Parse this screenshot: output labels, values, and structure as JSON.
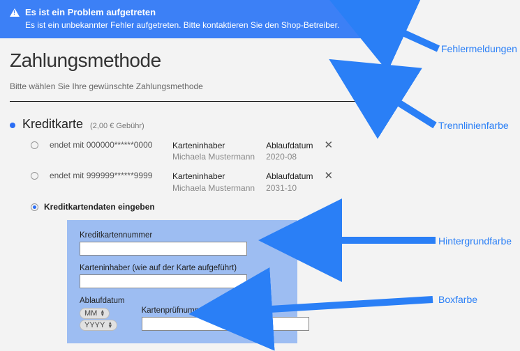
{
  "error": {
    "title": "Es ist ein Problem aufgetreten",
    "message": "Es ist ein unbekannter Fehler aufgetreten. Bitte kontaktieren Sie den Shop-Betreiber."
  },
  "page": {
    "title": "Zahlungsmethode",
    "instruction": "Bitte wählen Sie Ihre gewünschte Zahlungsmethode"
  },
  "method": {
    "name": "Kreditkarte",
    "fee": "(2,00 € Gebühr)"
  },
  "cards": [
    {
      "masked": "endet mit 000000******0000",
      "holder_label": "Karteninhaber",
      "holder_value": "Michaela Mustermann",
      "expiry_label": "Ablaufdatum",
      "expiry_value": "2020-08"
    },
    {
      "masked": "endet mit 999999******9999",
      "holder_label": "Karteninhaber",
      "holder_value": "Michaela Mustermann",
      "expiry_label": "Ablaufdatum",
      "expiry_value": "2031-10"
    }
  ],
  "enter_card_label": "Kreditkartendaten eingeben",
  "form": {
    "number_label": "Kreditkartennummer",
    "holder_label": "Karteninhaber (wie auf der Karte aufgeführt)",
    "expiry_label": "Ablaufdatum",
    "mm_placeholder": "MM",
    "yyyy_placeholder": "YYYY",
    "cvv_label": "Kartenprüfnummer"
  },
  "callouts": {
    "error": "Fehlermeldungen",
    "divider": "Trennlinienfarbe",
    "background": "Hintergrundfarbe",
    "box": "Boxfarbe"
  }
}
